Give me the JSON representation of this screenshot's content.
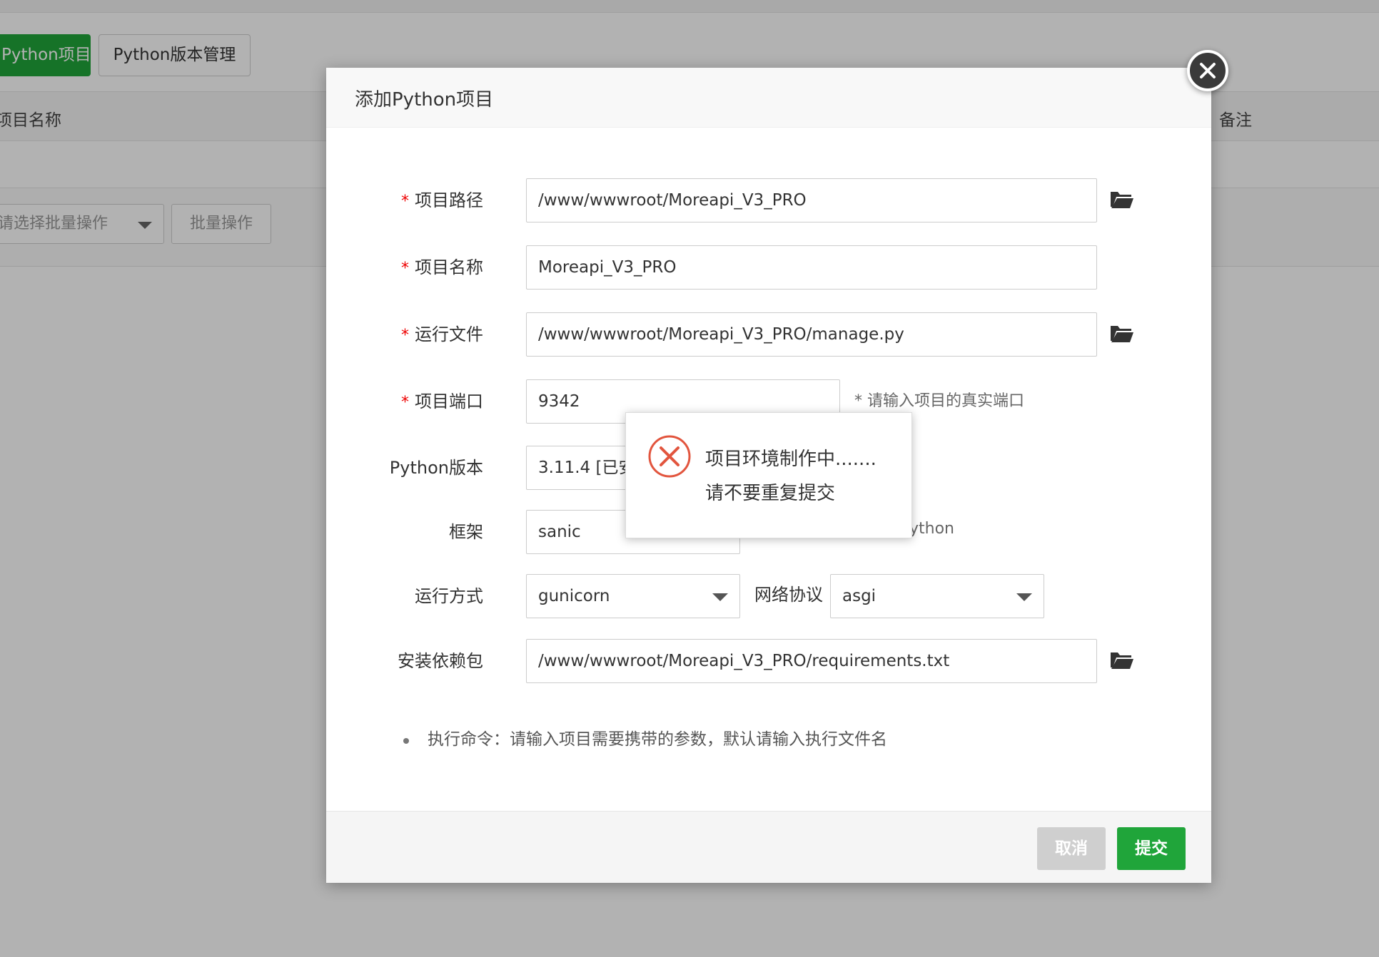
{
  "background": {
    "add_project_label": "Python项目",
    "version_mgmt_label": "Python版本管理",
    "col_project_name": "项目名称",
    "col_remark": "备注",
    "batch_select_placeholder": "请选择批量操作",
    "batch_button_label": "批量操作"
  },
  "dialog": {
    "title": "添加Python项目",
    "fields": {
      "project_path": {
        "label": "项目路径",
        "value": "/www/wwwroot/Moreapi_V3_PRO",
        "required": "*"
      },
      "project_name": {
        "label": "项目名称",
        "value": "Moreapi_V3_PRO",
        "required": "*"
      },
      "run_file": {
        "label": "运行文件",
        "value": "/www/wwwroot/Moreapi_V3_PRO/manage.py",
        "required": "*"
      },
      "project_port": {
        "label": "项目端口",
        "value": "9342",
        "required": "*",
        "hint": "* 请输入项目的真实端口"
      },
      "python_version": {
        "label": "Python版本",
        "value": "3.11.4 [已安"
      },
      "framework": {
        "label": "框架",
        "value": "sanic",
        "hint": "ython"
      },
      "run_mode": {
        "label": "运行方式",
        "value": "gunicorn"
      },
      "network_protocol": {
        "label": "网络协议",
        "value": "asgi"
      },
      "requirements": {
        "label": "安装依赖包",
        "value": "/www/wwwroot/Moreapi_V3_PRO/requirements.txt"
      }
    },
    "note": "执行命令：请输入项目需要携带的参数，默认请输入执行文件名",
    "cancel_label": "取消",
    "submit_label": "提交"
  },
  "toast": {
    "line1": "项目环境制作中.......",
    "line2": "请不要重复提交",
    "icon": "error-circle-icon"
  },
  "colors": {
    "primary_green": "#20a53a",
    "error_red": "#e2553e",
    "required_red": "#e00"
  }
}
